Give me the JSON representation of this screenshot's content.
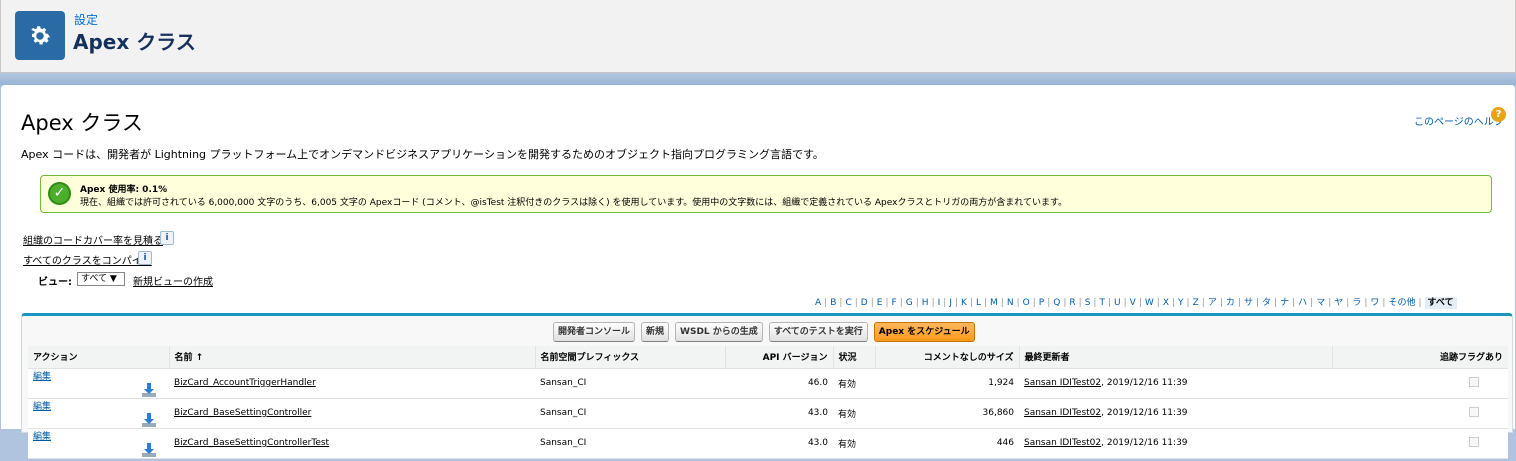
{
  "header": {
    "breadcrumb": "設定",
    "title": "Apex クラス"
  },
  "main": {
    "title": "Apex クラス",
    "help_link": "このページのヘルプ",
    "help_icon_text": "?",
    "description": "Apex コードは、開発者が Lightning プラットフォーム上でオンデマンドビジネスアプリケーションを開発するためのオブジェクト指向プログラミング言語です。",
    "usage": {
      "title": "Apex 使用率: 0.1%",
      "text": "現在、組織では許可されている 6,000,000 文字のうち、6,005 文字の Apexコード (コメント、@isTest 注釈付きのクラスは除く) を使用しています。使用中の文字数には、組織で定義されている Apexクラスとトリガの両方が含まれています。"
    },
    "links": {
      "coverage": "組織のコードカバー率を見積る",
      "compile": "すべてのクラスをコンパイル",
      "info": "i"
    },
    "view": {
      "label": "ビュー:",
      "selected": "すべて ▼",
      "new_view": "新規ビューの作成"
    },
    "alpha": [
      "A",
      "B",
      "C",
      "D",
      "E",
      "F",
      "G",
      "H",
      "I",
      "J",
      "K",
      "L",
      "M",
      "N",
      "O",
      "P",
      "Q",
      "R",
      "S",
      "T",
      "U",
      "V",
      "W",
      "X",
      "Y",
      "Z",
      "ア",
      "カ",
      "サ",
      "タ",
      "ナ",
      "ハ",
      "マ",
      "ヤ",
      "ラ",
      "ワ",
      "その他"
    ],
    "alpha_all": "すべて",
    "buttons": {
      "dev_console": "開発者コンソール",
      "new": "新規",
      "wsdl": "WSDL からの生成",
      "run_tests": "すべてのテストを実行",
      "schedule": "Apex をスケジュール"
    },
    "table": {
      "headers": {
        "action": "アクション",
        "name": "名前 ↑",
        "namespace": "名前空間プレフィックス",
        "api": "API バージョン",
        "status": "状況",
        "size": "コメントなしのサイズ",
        "modified": "最終更新者",
        "trace": "追跡フラグあり"
      },
      "rows": [
        {
          "action": "編集",
          "name": "BizCard_AccountTriggerHandler",
          "namespace": "Sansan_CI",
          "api": "46.0",
          "status": "有効",
          "size": "1,924",
          "modified_by": "Sansan IDITest02",
          "modified_date": ", 2019/12/16 11:39"
        },
        {
          "action": "編集",
          "name": "BizCard_BaseSettingController",
          "namespace": "Sansan_CI",
          "api": "43.0",
          "status": "有効",
          "size": "36,860",
          "modified_by": "Sansan IDITest02",
          "modified_date": ", 2019/12/16 11:39"
        },
        {
          "action": "編集",
          "name": "BizCard_BaseSettingControllerTest",
          "namespace": "Sansan_CI",
          "api": "43.0",
          "status": "有効",
          "size": "446",
          "modified_by": "Sansan IDITest02",
          "modified_date": ", 2019/12/16 11:39"
        }
      ]
    }
  }
}
